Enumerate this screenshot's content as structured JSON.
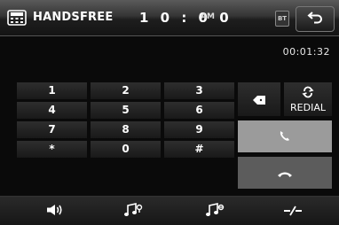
{
  "header": {
    "title": "HANDSFREE",
    "clock": "1 0 : 0 0",
    "ampm": "AM",
    "bt_label": "BT"
  },
  "call": {
    "timer": "00:01:32"
  },
  "keypad": {
    "keys": [
      [
        "1",
        "2",
        "3"
      ],
      [
        "4",
        "5",
        "6"
      ],
      [
        "7",
        "8",
        "9"
      ],
      [
        "*",
        "0",
        "#"
      ]
    ]
  },
  "controls": {
    "redial_label": "REDIAL"
  },
  "icons": {
    "phone": "handset-keypad-icon",
    "back": "back-arrow-icon",
    "delete": "backspace-icon",
    "redial": "redial-icon",
    "call": "call-icon",
    "end": "end-call-icon",
    "volume": "volume-icon",
    "music_prev": "music-note-icon",
    "music_next": "music-note-icon",
    "mute": "mic-mute-icon"
  },
  "colors": {
    "call_button": "#9b9b9b",
    "end_button": "#5c5c5c",
    "background": "#0a0a0a"
  }
}
